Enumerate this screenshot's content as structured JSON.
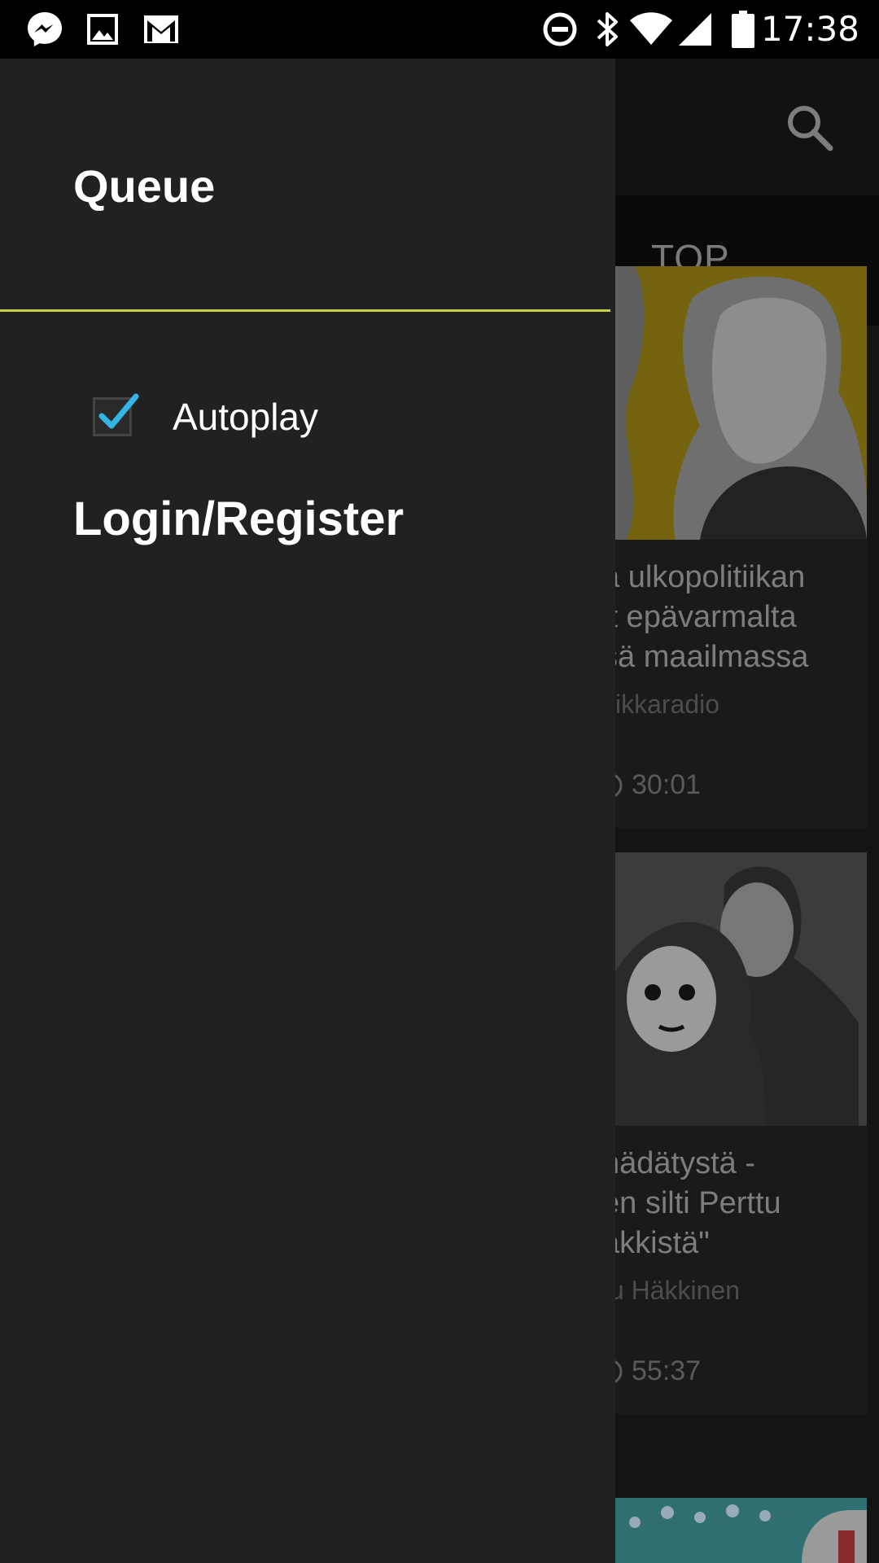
{
  "status_bar": {
    "time": "17:38",
    "left_icons": [
      "messenger-icon",
      "gallery-icon",
      "gmail-icon"
    ],
    "right_icons": [
      "do-not-disturb-icon",
      "bluetooth-icon",
      "wifi-icon",
      "signal-icon",
      "battery-icon"
    ]
  },
  "drawer": {
    "title": "Queue",
    "divider_color": "#c3cf45",
    "autoplay_label": "Autoplay",
    "autoplay_checked": true,
    "login_label": "Login/Register"
  },
  "background": {
    "tab_label": "TOP",
    "cards": [
      {
        "title": "a ulkopolitiikan\nit epävarmalta\nsä maailmassa",
        "subtitle": "tiikkaradio",
        "duration": "30:01"
      },
      {
        "title": "nädätystä -\nen silti Perttu\näkkistä\"",
        "subtitle": "tu Häkkinen",
        "duration": "55:37"
      }
    ]
  },
  "colors": {
    "accent": "#c3cf45",
    "checkbox_check": "#33b5e5",
    "drawer_bg": "#212121"
  }
}
